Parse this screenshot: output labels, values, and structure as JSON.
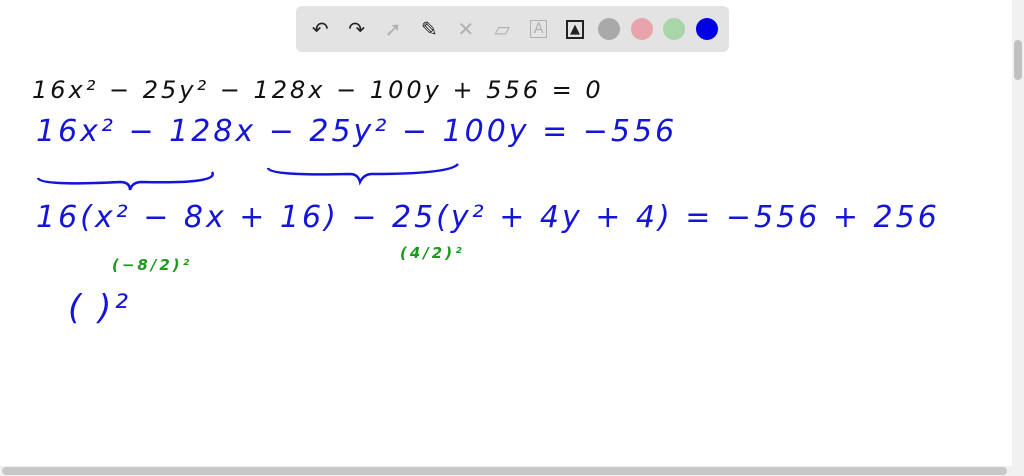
{
  "toolbar": {
    "tools": [
      "undo-icon",
      "redo-icon",
      "select-icon",
      "pen-icon",
      "tools-icon",
      "eraser-icon",
      "text-icon",
      "image-icon"
    ],
    "colors": [
      "#a9a9a9",
      "#e8a3ab",
      "#a9d6a9",
      "#0000e6"
    ]
  },
  "board": {
    "line1": "16x² − 25y² − 128x − 100y + 556 = 0",
    "line2": "16x² − 128x − 25y² − 100y = −556",
    "line3": "16(x² − 8x + 16) − 25(y² + 4y + 4) = −556 + 256",
    "note1": "(−8/2)²",
    "note2": "(4/2)²",
    "line4": "(             )²"
  }
}
